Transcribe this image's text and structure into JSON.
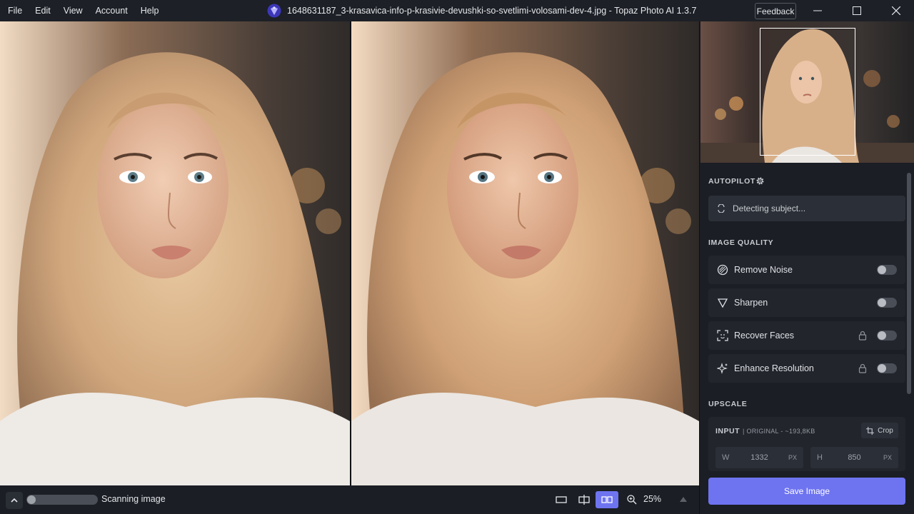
{
  "menu": {
    "items": [
      "File",
      "Edit",
      "View",
      "Account",
      "Help"
    ]
  },
  "window": {
    "title": "1648631187_3-krasavica-info-p-krasivie-devushki-so-svetlimi-volosami-dev-4.jpg - Topaz Photo AI 1.3.7",
    "feedback_label": "Feedback",
    "icons": [
      "minimize-icon",
      "maximize-icon",
      "close-icon"
    ]
  },
  "status": {
    "scan_text": "Scanning image",
    "progress": 0.0,
    "zoom": "25%"
  },
  "sidebar": {
    "autopilot_title": "AUTOPILOT",
    "detecting_text": "Detecting subject...",
    "image_quality_title": "IMAGE QUALITY",
    "features": [
      {
        "label": "Remove Noise",
        "enabled": false,
        "locked": false,
        "icon": "noise-icon"
      },
      {
        "label": "Sharpen",
        "enabled": false,
        "locked": false,
        "icon": "sharpen-icon"
      },
      {
        "label": "Recover Faces",
        "enabled": false,
        "locked": true,
        "icon": "face-icon"
      },
      {
        "label": "Enhance Resolution",
        "enabled": false,
        "locked": true,
        "icon": "sparkle-icon"
      }
    ],
    "upscale_title": "UPSCALE",
    "input_label": "INPUT",
    "input_sub": "| ORIGINAL - ~193,8KB",
    "crop_label": "Crop",
    "width_label": "W",
    "width_value": "1332",
    "height_label": "H",
    "height_value": "850",
    "unit": "PX",
    "save_label": "Save Image"
  },
  "colors": {
    "accent": "#6e74f0",
    "background": "#1b1e24",
    "panel": "#22252c"
  }
}
